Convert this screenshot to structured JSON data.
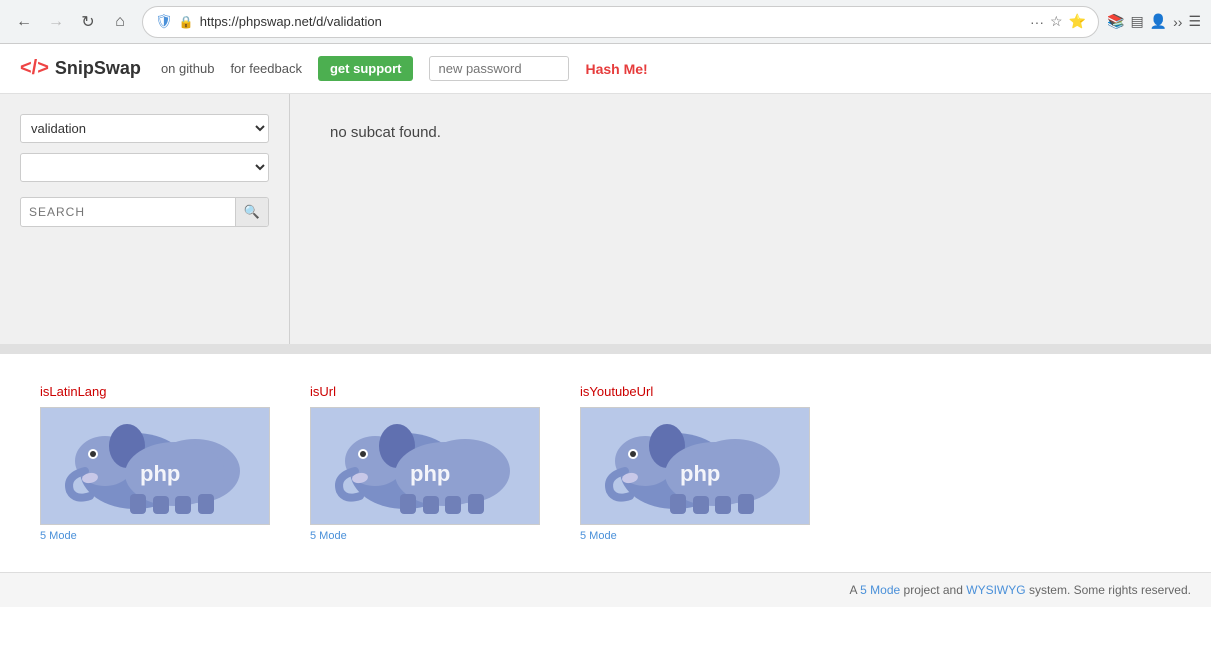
{
  "browser": {
    "url": "https://phpswap.net/d/validation",
    "back_disabled": false,
    "forward_disabled": true
  },
  "header": {
    "logo_text": "SnipSwap",
    "nav": {
      "github_label": "on github",
      "feedback_label": "for feedback",
      "support_label": "get support",
      "password_placeholder": "new password",
      "hash_me_label": "Hash Me!"
    }
  },
  "sidebar": {
    "category_selected": "validation",
    "category_options": [
      "validation"
    ],
    "subcategory_selected": "",
    "subcategory_options": [],
    "search_placeholder": "SEARCH"
  },
  "content": {
    "no_subcat_message": "no subcat found."
  },
  "snippets": {
    "items": [
      {
        "title": "isLatinLang",
        "mode": "5 Mode"
      },
      {
        "title": "isUrl",
        "mode": "5 Mode"
      },
      {
        "title": "isYoutubeUrl",
        "mode": "5 Mode"
      }
    ]
  },
  "footer": {
    "text_prefix": "A",
    "mode_link": "5 Mode",
    "text_middle": "project and",
    "wysiwyg_link": "WYSIWYG",
    "text_suffix": "system. Some rights reserved."
  }
}
